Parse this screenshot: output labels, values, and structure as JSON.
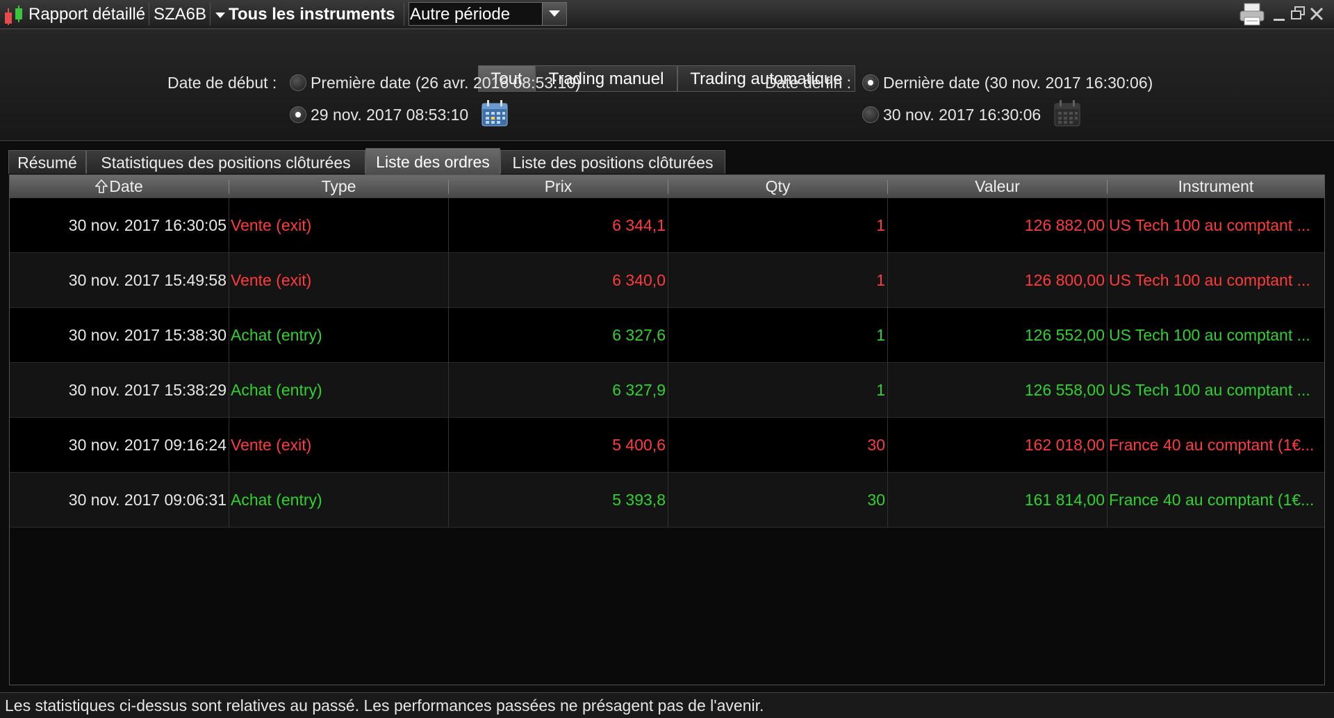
{
  "titlebar": {
    "app_title": "Rapport détaillé",
    "account": "SZA6B",
    "instruments": "Tous les instruments",
    "period": "Autre période"
  },
  "mode_tabs": [
    "Tout",
    "Trading manuel",
    "Trading automatique"
  ],
  "mode_active": "Tout",
  "start": {
    "label": "Date de début :",
    "first_date": "Première date (26 avr. 2016 08:53:10)",
    "custom_date": "29 nov. 2017 08:53:10",
    "selected": "custom"
  },
  "end": {
    "label": "Date de fin :",
    "last_date": "Dernière date (30 nov. 2017 16:30:06)",
    "custom_date": "30 nov. 2017 16:30:06",
    "selected": "last"
  },
  "tabs": [
    "Résumé",
    "Statistiques des positions clôturées",
    "Liste des ordres",
    "Liste des positions clôturées"
  ],
  "active_tab": "Liste des ordres",
  "table": {
    "sort_icon": "arrow-up-icon",
    "columns": [
      "Date",
      "Type",
      "Prix",
      "Qty",
      "Valeur",
      "Instrument"
    ],
    "rows": [
      {
        "date": "30 nov. 2017 16:30:05",
        "type": "Vente (exit)",
        "price": "6 344,1",
        "qty": "1",
        "value": "126 882,00",
        "instrument": "US Tech 100 au comptant ...",
        "side": "sell"
      },
      {
        "date": "30 nov. 2017 15:49:58",
        "type": "Vente (exit)",
        "price": "6 340,0",
        "qty": "1",
        "value": "126 800,00",
        "instrument": "US Tech 100 au comptant ...",
        "side": "sell"
      },
      {
        "date": "30 nov. 2017 15:38:30",
        "type": "Achat (entry)",
        "price": "6 327,6",
        "qty": "1",
        "value": "126 552,00",
        "instrument": "US Tech 100 au comptant ...",
        "side": "buy"
      },
      {
        "date": "30 nov. 2017 15:38:29",
        "type": "Achat (entry)",
        "price": "6 327,9",
        "qty": "1",
        "value": "126 558,00",
        "instrument": "US Tech 100 au comptant ...",
        "side": "buy"
      },
      {
        "date": "30 nov. 2017 09:16:24",
        "type": "Vente (exit)",
        "price": "5 400,6",
        "qty": "30",
        "value": "162 018,00",
        "instrument": "France 40 au comptant (1€...",
        "side": "sell"
      },
      {
        "date": "30 nov. 2017 09:06:31",
        "type": "Achat (entry)",
        "price": "5 393,8",
        "qty": "30",
        "value": "161 814,00",
        "instrument": "France 40 au comptant (1€...",
        "side": "buy"
      }
    ]
  },
  "footer": "Les statistiques ci-dessus sont relatives au passé. Les performances passées ne présagent pas de l'avenir.",
  "colors": {
    "sell": "#ff3b3b",
    "buy": "#2fd22f"
  }
}
